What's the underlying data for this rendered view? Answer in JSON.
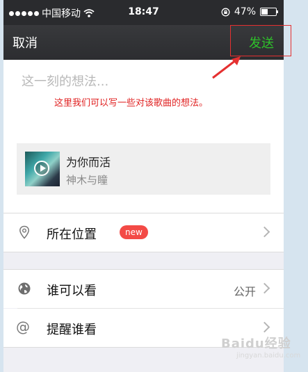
{
  "status_bar": {
    "carrier": "中国移动",
    "time": "18:47",
    "battery": "47%",
    "battery_level": 0.47
  },
  "nav": {
    "cancel_label": "取消",
    "send_label": "发送"
  },
  "compose": {
    "placeholder": "这一刻的想法...",
    "annotation": "这里我们可以写一些对该歌曲的想法。"
  },
  "music_card": {
    "title": "为你而活",
    "artist": "神木与瞳"
  },
  "options": {
    "location_label": "所在位置",
    "location_badge": "new",
    "visibility_label": "谁可以看",
    "visibility_value": "公开",
    "remind_label": "提醒谁看",
    "remind_symbol": "@"
  },
  "watermark": {
    "brand": "Baidu经验",
    "url": "jingyan.baidu.com"
  },
  "colors": {
    "send_accent": "#2ec12a",
    "badge": "#f34a46",
    "annotation": "#e53030",
    "nav_background": "#2c2d30"
  },
  "icons": [
    "wifi-icon",
    "rotation-lock-icon",
    "battery-icon",
    "play-icon",
    "location-pin-icon",
    "globe-icon",
    "at-icon",
    "chevron-right-icon"
  ]
}
